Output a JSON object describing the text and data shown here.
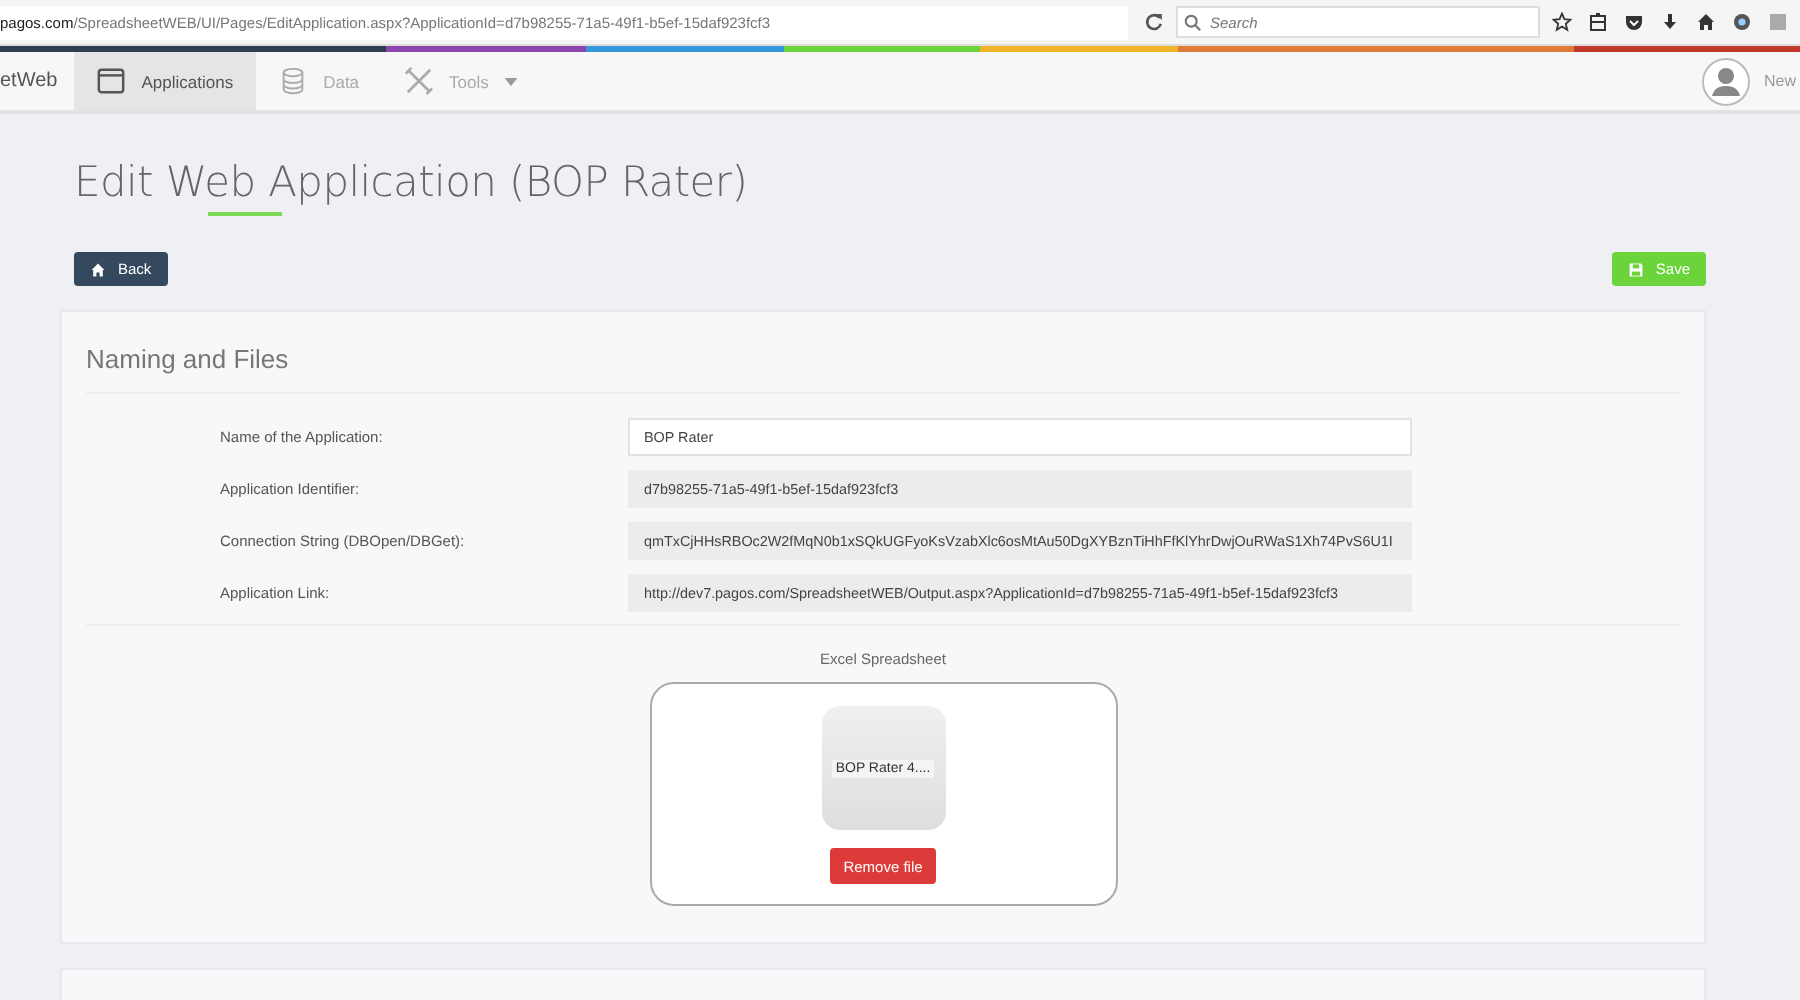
{
  "browser": {
    "url_host": "pagos.com",
    "url_path": "/SpreadsheetWEB/UI/Pages/EditApplication.aspx?ApplicationId=d7b98255-71a5-49f1-b5ef-15daf923fcf3",
    "search": {
      "placeholder": "Search"
    }
  },
  "nav": {
    "brand": "etWeb",
    "tabs": [
      {
        "label": "Applications",
        "selected": true,
        "dropdown": false
      },
      {
        "label": "Data",
        "selected": false,
        "dropdown": false
      },
      {
        "label": "Tools",
        "selected": false,
        "dropdown": true
      }
    ],
    "user": "New"
  },
  "page": {
    "title": "Edit Web Application (BOP Rater)",
    "back": "Back",
    "save": "Save"
  },
  "card": {
    "title": "Naming and Files",
    "fields": [
      {
        "label": "Name of the Application:",
        "value": "BOP Rater",
        "readonly": false
      },
      {
        "label": "Application Identifier:",
        "value": "d7b98255-71a5-49f1-b5ef-15daf923fcf3",
        "readonly": true
      },
      {
        "label": "Connection String (DBOpen/DBGet):",
        "value": "qmTxCjHHsRBOc2W2fMqN0b1xSQkUGFyoKsVzabXlc6osMtAu50DgXYBznTiHhFfKlYhrDwjOuRWaS1Xh74PvS6U1I",
        "readonly": true
      },
      {
        "label": "Application Link:",
        "value": "http://dev7.pagos.com/SpreadsheetWEB/Output.aspx?ApplicationId=d7b98255-71a5-49f1-b5ef-15daf923fcf3",
        "readonly": true
      }
    ],
    "file": {
      "label": "Excel Spreadsheet",
      "name": "BOP Rater 4....",
      "remove": "Remove file"
    }
  }
}
